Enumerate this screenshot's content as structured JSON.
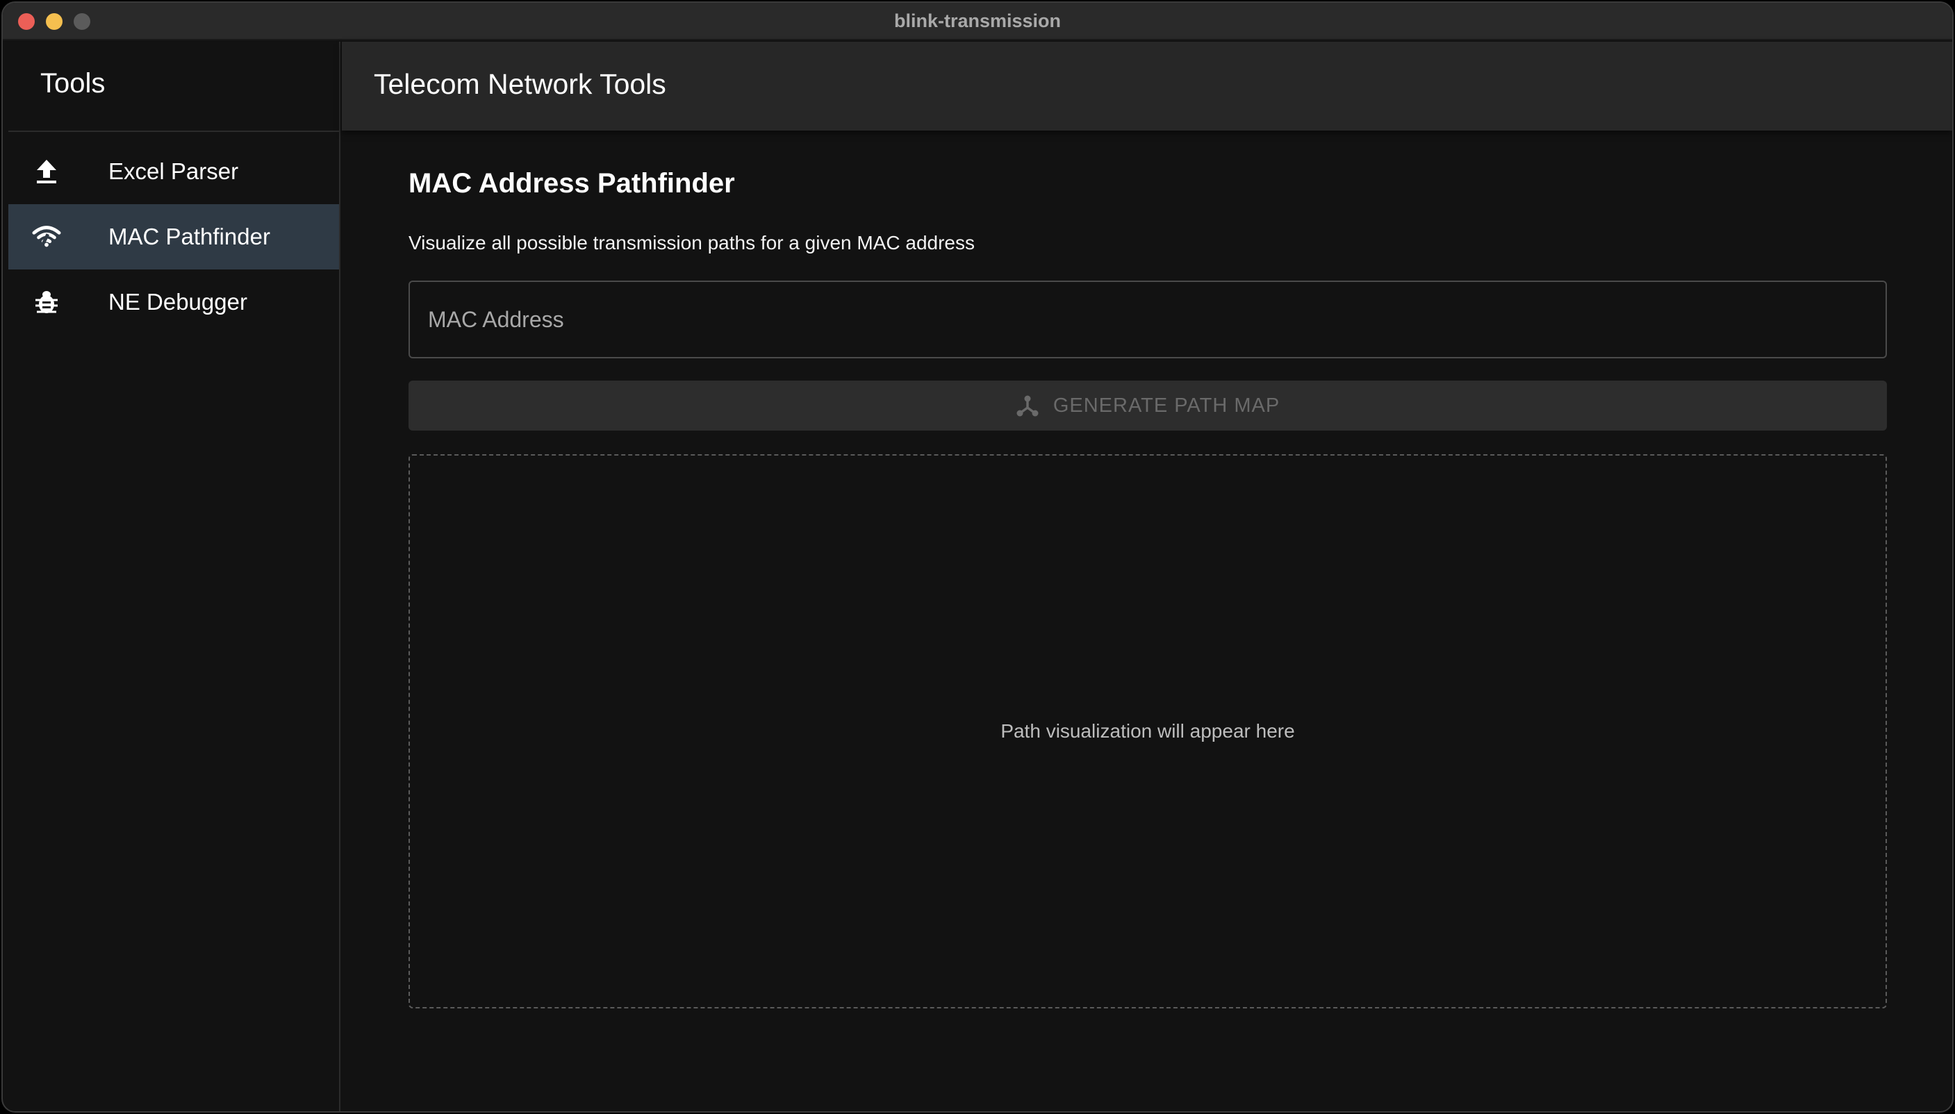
{
  "window": {
    "title": "blink-transmission"
  },
  "sidebar": {
    "title": "Tools",
    "items": [
      {
        "label": "Excel Parser",
        "icon": "upload-icon",
        "active": false
      },
      {
        "label": "MAC Pathfinder",
        "icon": "wifi-signal-icon",
        "active": true
      },
      {
        "label": "NE Debugger",
        "icon": "bug-icon",
        "active": false
      }
    ]
  },
  "appbar": {
    "title": "Telecom Network Tools"
  },
  "main": {
    "section_title": "MAC Address Pathfinder",
    "description": "Visualize all possible transmission paths for a given MAC address",
    "mac_input": {
      "placeholder": "MAC Address",
      "value": ""
    },
    "generate_button": {
      "label": "GENERATE PATH MAP",
      "icon": "hub-icon",
      "disabled": true
    },
    "visualization": {
      "placeholder": "Path visualization will appear here"
    }
  },
  "colors": {
    "background": "#121212",
    "appbar": "#272727",
    "active_item": "#2f3a45",
    "traffic_close": "#ec5f57",
    "traffic_minimize": "#f5bf4f"
  }
}
